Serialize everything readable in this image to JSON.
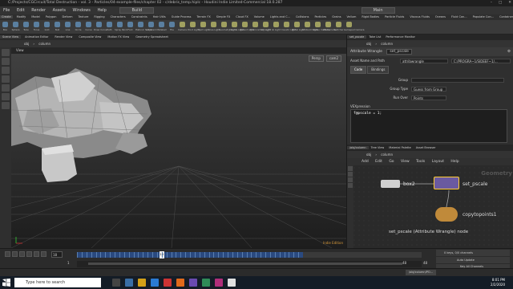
{
  "title_bar": {
    "title": "C:/Projects/CGCircuit/Total Destruction - vol. 3 - Particles/04-example-files/chapter 02 - c/debris_temp.hiplc - Houdini Indie Limited-Commercial 18.0.287"
  },
  "menu": {
    "items": [
      "File",
      "Edit",
      "Render",
      "Assets",
      "Windows",
      "Help"
    ],
    "build_label": "Build",
    "mode_label": "Main"
  },
  "shelf_tabs": [
    "Create",
    "Modify",
    "Model",
    "Polygon",
    "Deform",
    "Texture",
    "Rigging",
    "Characters",
    "Constraints",
    "Hair Utils",
    "Guide Process",
    "Terrain FX",
    "Simple FX",
    "Cloud FX",
    "Volume",
    "Lights and C...",
    "Collisions",
    "Particles",
    "Grains",
    "Vellum",
    "Rigid Bodies",
    "Particle Fluids",
    "Viscous Fluids",
    "Oceans",
    "Fluid Con...",
    "Populate Con...",
    "Container Tools",
    "Pyro FX",
    "Sparse Pyro FX",
    "FEM",
    "Wires",
    "Crowds",
    "Drive Simulation"
  ],
  "shelf_tools": [
    "Box",
    "Sphere",
    "Tube",
    "Torus",
    "Grid",
    "Null",
    "Line",
    "Circle",
    "Curve",
    "Draw Curve",
    "Path",
    "Spray Paint",
    "Font",
    "Platonic Solids",
    "L-System",
    "Metaball",
    "File",
    "Camera",
    "Point Light",
    "Spot Light",
    "Area Light",
    "Geometry Light",
    "Volume Light",
    "Distant Light",
    "Environment Light",
    "Sky Light",
    "GI Light",
    "Caustic Light",
    "Portal Light",
    "Ambient Light",
    "Stereo Camera",
    "VR Camera",
    "Switcher",
    "Gamepad Camera"
  ],
  "left_panel_tabs": [
    "Scene View",
    "Animation Editor",
    "Render View",
    "Composite View",
    "Motion FX View",
    "Geometry Spreadsheet"
  ],
  "viewport": {
    "path": [
      "obj",
      "column"
    ],
    "label": "View",
    "persp": "Persp",
    "camera": "cam2",
    "watermark": "Indie Edition"
  },
  "right_panel_tabs": [
    "set_pscale",
    "Take List",
    "Performance Monitor"
  ],
  "params": {
    "path": [
      "obj",
      "column"
    ],
    "node_type": "Attribute Wrangle",
    "node_name": "set_pscale",
    "asset_label": "Asset Name and Path",
    "asset_value": "attribwrangle",
    "asset_path": "C:/PROGRA~1/SIDEEF~1/...",
    "tabs": [
      "Code",
      "Bindings"
    ],
    "group_label": "Group",
    "group_type_label": "Group Type",
    "group_type_value": "Guess from Group",
    "run_over_label": "Run Over",
    "run_over_value": "Points",
    "vex_label": "VEXpression",
    "vex_code": "f@pscale = 1;"
  },
  "network": {
    "tabs": [
      "/obj/column",
      "Tree View",
      "Material Palette",
      "Asset Browser"
    ],
    "path": [
      "obj",
      "column"
    ],
    "menu": [
      "Add",
      "Edit",
      "Go",
      "View",
      "Tools",
      "Layout",
      "Help"
    ],
    "watermark": "Geometry",
    "nodes": [
      {
        "name": "box2",
        "color": "#d0d0d0"
      },
      {
        "name": "set_pscale",
        "color": "#6a5aa0"
      },
      {
        "name": "copytopoints1",
        "color": "#c08a3a"
      }
    ],
    "selected_caption": "set_pscale (Attribute Wrangle) node"
  },
  "timeline": {
    "frame": "18",
    "cursor_label": "18",
    "range_start": "1",
    "range_end": "48",
    "end_value": "48",
    "keys_label": "0 keys, 0/0 channels",
    "key_all_label": "Key All Channels",
    "auto_update": "Auto Update"
  },
  "status": {
    "path": "/obj/column/PO..."
  },
  "taskbar": {
    "search": "Type here to search",
    "time": "8:01 PM",
    "date": "2/2/2020"
  }
}
